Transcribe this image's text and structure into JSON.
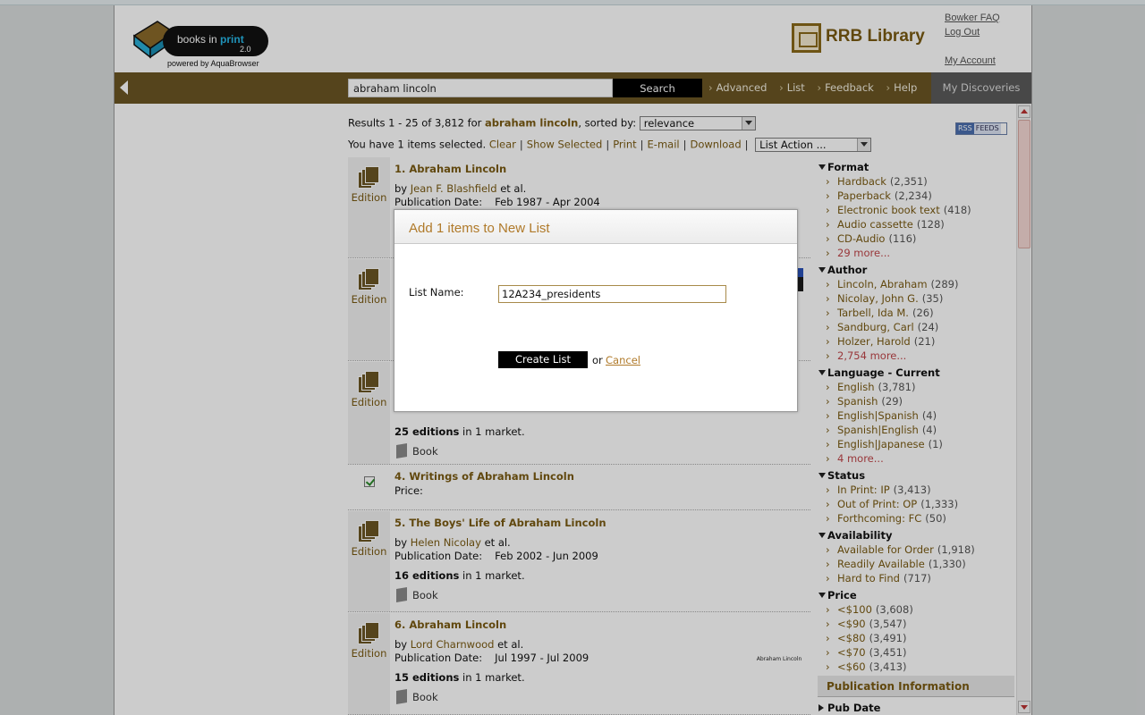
{
  "header": {
    "logo": {
      "line1": "books in",
      "line1_accent": "print",
      "version": "2.0",
      "powered": "powered by AquaBrowser"
    },
    "library_name": "RRB Library",
    "links": [
      "Bowker FAQ",
      "Log Out",
      "My Account"
    ]
  },
  "nav": {
    "search_value": "abraham lincoln",
    "search_button": "Search",
    "links": [
      "Advanced",
      "List",
      "Feedback",
      "Help"
    ],
    "my_discoveries": "My Discoveries"
  },
  "results_header": {
    "prefix": "Results 1 - 25 of 3,812 for",
    "query": "abraham lincoln",
    "sorted_by": ", sorted by:",
    "sort_value": "relevance"
  },
  "selection": {
    "text": "You have 1 items selected.",
    "links": [
      "Clear",
      "Show Selected",
      "Print",
      "E-mail",
      "Download"
    ],
    "list_action": "List Action ..."
  },
  "rss": {
    "rss": "RSS",
    "feeds": "FEEDS"
  },
  "results": [
    {
      "title": "1. Abraham Lincoln",
      "by": "by",
      "author": "Jean F. Blashfield",
      "etal": "et al.",
      "pub_label": "Publication Date:",
      "pub_value": "Feb 1987 - Apr 2004",
      "edition_label": "Edition"
    },
    {
      "edition_label": "Edition"
    },
    {
      "edition_label": "Edition",
      "editions_count": "25 editions",
      "editions_suffix": "in 1 market.",
      "format": "Book"
    },
    {
      "title": "4. Writings of Abraham Lincoln",
      "price_label": "Price:"
    },
    {
      "title": "5. The Boys' Life of Abraham Lincoln",
      "by": "by",
      "author": "Helen Nicolay",
      "etal": "et al.",
      "pub_label": "Publication Date:",
      "pub_value": "Feb 2002 - Jun 2009",
      "editions_count": "16 editions",
      "editions_suffix": "in 1 market.",
      "format": "Book",
      "edition_label": "Edition"
    },
    {
      "title": "6. Abraham Lincoln",
      "by": "by",
      "author": "Lord Charnwood",
      "etal": "et al.",
      "pub_label": "Publication Date:",
      "pub_value": "Jul 1997 - Jul 2009",
      "editions_count": "15 editions",
      "editions_suffix": "in 1 market.",
      "format": "Book",
      "edition_label": "Edition",
      "cover_text": "Abraham Lincoln"
    }
  ],
  "facets": [
    {
      "name": "Format",
      "items": [
        [
          "Hardback",
          "(2,351)"
        ],
        [
          "Paperback",
          "(2,234)"
        ],
        [
          "Electronic book text",
          "(418)"
        ],
        [
          "Audio cassette",
          "(128)"
        ],
        [
          "CD-Audio",
          "(116)"
        ]
      ],
      "more": "29 more..."
    },
    {
      "name": "Author",
      "items": [
        [
          "Lincoln, Abraham",
          "(289)"
        ],
        [
          "Nicolay, John G.",
          "(35)"
        ],
        [
          "Tarbell, Ida M.",
          "(26)"
        ],
        [
          "Sandburg, Carl",
          "(24)"
        ],
        [
          "Holzer, Harold",
          "(21)"
        ]
      ],
      "more": "2,754 more..."
    },
    {
      "name": "Language - Current",
      "items": [
        [
          "English",
          "(3,781)"
        ],
        [
          "Spanish",
          "(29)"
        ],
        [
          "English|Spanish",
          "(4)"
        ],
        [
          "Spanish|English",
          "(4)"
        ],
        [
          "English|Japanese",
          "(1)"
        ]
      ],
      "more": "4 more..."
    },
    {
      "name": "Status",
      "items": [
        [
          "In Print: IP",
          "(3,413)"
        ],
        [
          "Out of Print: OP",
          "(1,333)"
        ],
        [
          "Forthcoming: FC",
          "(50)"
        ]
      ]
    },
    {
      "name": "Availability",
      "items": [
        [
          "Available for Order",
          "(1,918)"
        ],
        [
          "Readily Available",
          "(1,330)"
        ],
        [
          "Hard to Find",
          "(717)"
        ]
      ]
    },
    {
      "name": "Price",
      "items": [
        [
          "<$100",
          "(3,608)"
        ],
        [
          "<$90",
          "(3,547)"
        ],
        [
          "<$80",
          "(3,491)"
        ],
        [
          "<$70",
          "(3,451)"
        ],
        [
          "<$60",
          "(3,413)"
        ]
      ]
    }
  ],
  "pub_info": "Publication Information",
  "pub_date": "Pub Date",
  "modal": {
    "title": "Add 1 items to New List",
    "list_name_label": "List Name:",
    "list_name_value": "12A234_presidents",
    "create_button": "Create List",
    "or": "or",
    "cancel": "Cancel"
  },
  "colors": {
    "brand_brown": "#6b5623",
    "link_brown": "#7a5a12",
    "more_red": "#c0464a",
    "modal_title": "#b07a2a"
  }
}
